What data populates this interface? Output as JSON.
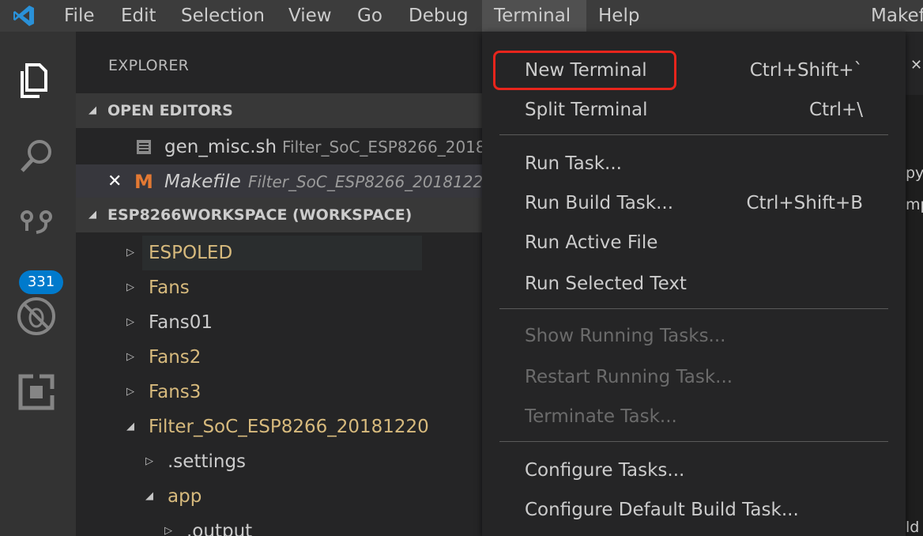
{
  "menubar": {
    "items": [
      "File",
      "Edit",
      "Selection",
      "View",
      "Go",
      "Debug",
      "Terminal",
      "Help"
    ],
    "window_title": "Makef"
  },
  "activitybar": {
    "scm_badge": "331"
  },
  "explorer": {
    "title": "EXPLORER",
    "open_editors_header": "OPEN EDITORS",
    "open_editors": [
      {
        "name": "gen_misc.sh",
        "desc": "Filter_SoC_ESP8266_2018"
      },
      {
        "name": "Makefile",
        "desc": "Filter_SoC_ESP8266_2018122"
      }
    ],
    "workspace_header": "ESP8266WORKSPACE (WORKSPACE)",
    "tree": [
      {
        "name": "ESPOLED"
      },
      {
        "name": "Fans"
      },
      {
        "name": "Fans01"
      },
      {
        "name": "Fans2"
      },
      {
        "name": "Fans3"
      },
      {
        "name": "Filter_SoC_ESP8266_20181220"
      },
      {
        "name": ".settings"
      },
      {
        "name": "app"
      },
      {
        "name": ".output"
      }
    ]
  },
  "terminal_menu": {
    "items": [
      {
        "label": "New Terminal",
        "shortcut": "Ctrl+Shift+`"
      },
      {
        "label": "Split Terminal",
        "shortcut": "Ctrl+\\"
      },
      {
        "label": "Run Task...",
        "shortcut": ""
      },
      {
        "label": "Run Build Task...",
        "shortcut": "Ctrl+Shift+B"
      },
      {
        "label": "Run Active File",
        "shortcut": ""
      },
      {
        "label": "Run Selected Text",
        "shortcut": ""
      },
      {
        "label": "Show Running Tasks...",
        "shortcut": ""
      },
      {
        "label": "Restart Running Task...",
        "shortcut": ""
      },
      {
        "label": "Terminate Task...",
        "shortcut": ""
      },
      {
        "label": "Configure Tasks...",
        "shortcut": ""
      },
      {
        "label": "Configure Default Build Task...",
        "shortcut": ""
      }
    ]
  },
  "editor_edge": {
    "close_glyph": "✕",
    "fragments": [
      "py",
      "mp",
      "ld"
    ]
  },
  "colors": {
    "accent": "#007acc",
    "highlight": "#e8251c",
    "folder_text": "#d7ba7d"
  }
}
